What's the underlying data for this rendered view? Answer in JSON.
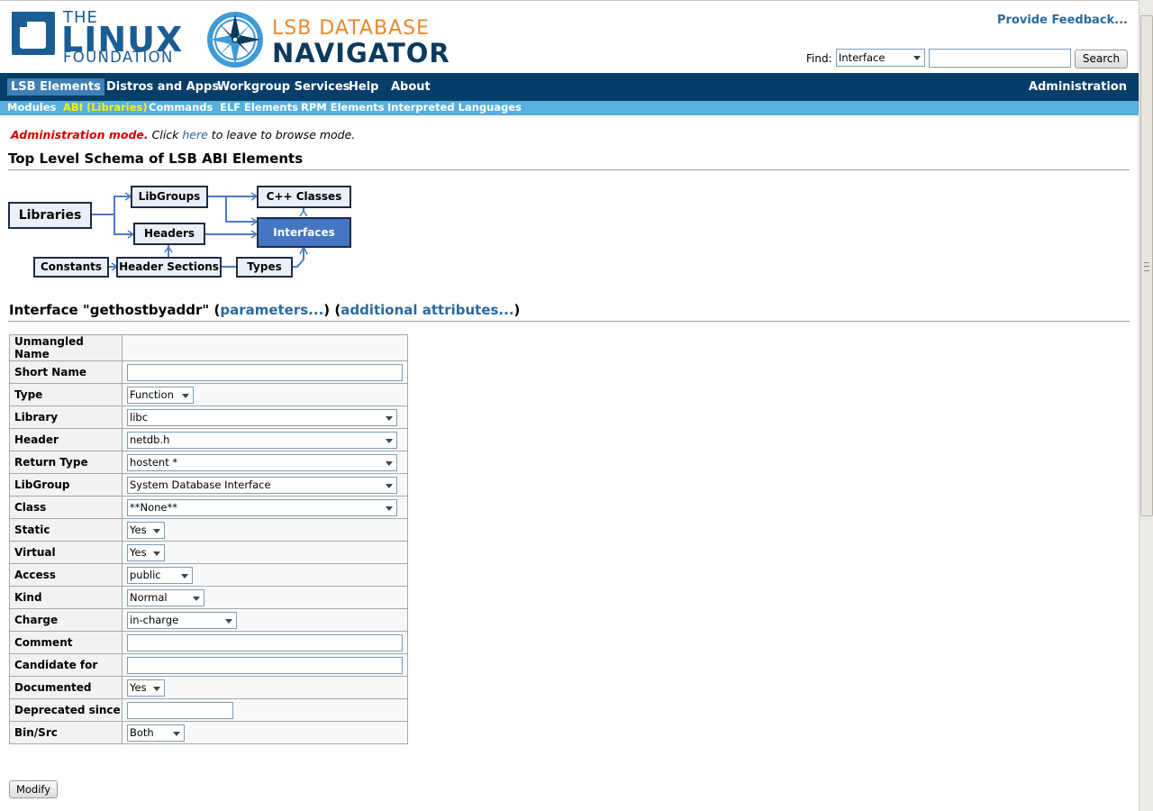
{
  "header": {
    "lf_logo": {
      "the": "THE",
      "linux": "LINUX",
      "foundation": "FOUNDATION"
    },
    "lsb_logo": {
      "line1": "LSB DATABASE",
      "line2": "NAVIGATOR"
    },
    "feedback_link": "Provide Feedback...",
    "find": {
      "label": "Find:",
      "selected": "Interface",
      "query": "",
      "button": "Search"
    }
  },
  "nav": {
    "primary": [
      "LSB Elements",
      "Distros and Apps",
      "Workgroup Services",
      "Help",
      "About"
    ],
    "admin": "Administration",
    "secondary": [
      "Modules",
      "ABI (Libraries)",
      "Commands",
      "ELF Elements",
      "RPM Elements",
      "Interpreted Languages"
    ]
  },
  "admin_notice": {
    "mode": "Administration mode.",
    "pre": " Click ",
    "link": "here",
    "post": " to leave to browse mode."
  },
  "schema": {
    "title": "Top Level Schema of LSB ABI Elements",
    "boxes": {
      "libraries": "Libraries",
      "libgroups": "LibGroups",
      "cpp_classes": "C++ Classes",
      "headers": "Headers",
      "interfaces": "Interfaces",
      "constants": "Constants",
      "header_sections": "Header Sections",
      "types": "Types"
    }
  },
  "interface": {
    "title_pre": "Interface \"gethostbyaddr\" (",
    "params_link": "parameters...",
    "title_mid": ") (",
    "attrs_link": "additional attributes...",
    "title_post": ")"
  },
  "form": {
    "labels": {
      "unmangled": "Unmangled Name",
      "short_name": "Short Name",
      "type": "Type",
      "library": "Library",
      "header": "Header",
      "return_type": "Return Type",
      "libgroup": "LibGroup",
      "class": "Class",
      "static": "Static",
      "virtual": "Virtual",
      "access": "Access",
      "kind": "Kind",
      "charge": "Charge",
      "comment": "Comment",
      "candidate": "Candidate for",
      "documented": "Documented",
      "deprecated": "Deprecated since",
      "binsrc": "Bin/Src"
    },
    "values": {
      "unmangled": "",
      "short_name": "",
      "type": "Function",
      "library": "libc",
      "header": "netdb.h",
      "return_type": "hostent *",
      "libgroup": "System Database Interface",
      "class": "**None**",
      "static": "Yes",
      "virtual": "Yes",
      "access": "public",
      "kind": "Normal",
      "charge": "in-charge",
      "comment": "",
      "candidate": "",
      "documented": "Yes",
      "deprecated": "",
      "binsrc": "Both"
    },
    "submit": "Modify"
  },
  "colors": {
    "nav_primary": "#063e6a",
    "nav_secondary": "#57b0de",
    "link": "#2c6a9c",
    "admin_red": "#d20000",
    "highlight_box": "#4476c4"
  }
}
